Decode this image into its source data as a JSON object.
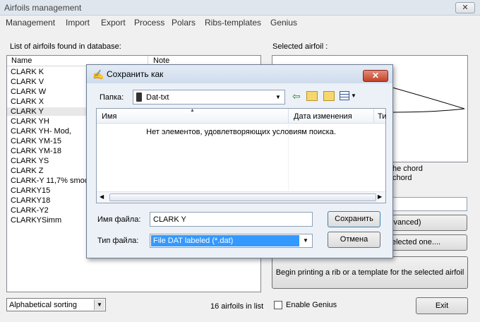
{
  "window": {
    "title": "Airfoils management",
    "close_glyph": "✕"
  },
  "menu": [
    "Management",
    "Import",
    "Export",
    "Process",
    "Polars",
    "Ribs-templates",
    "Genius"
  ],
  "left": {
    "list_label": "List of airfoils found in database:",
    "columns": [
      "Name",
      "Note"
    ],
    "airfoils": [
      "CLARK K",
      "CLARK V",
      "CLARK W",
      "CLARK X",
      "CLARK Y",
      "CLARK YH",
      "CLARK YH- Mod,",
      "CLARK YM-15",
      "CLARK YM-18",
      "CLARK YS",
      "CLARK Z",
      "CLARK-Y 11,7% smoot",
      "CLARKY15",
      "CLARKY18",
      "CLARK-Y2",
      "CLARKYSimm"
    ],
    "selected_index": 4,
    "sort_value": "Alphabetical sorting",
    "count_text": "16 airfoils in list"
  },
  "right": {
    "selected_label": "Selected airfoil :",
    "chord_line1": "he chord",
    "chord_line2": "chord",
    "btn_advanced": "lvanced)",
    "btn_selected": "elected one....",
    "btn_print": "Begin printing a rib or a template for the selected airfoil",
    "genius_label": "Enable Genius",
    "exit_label": "Exit"
  },
  "dialog": {
    "title": "Сохранить как",
    "folder_label": "Папка:",
    "folder_value": "Dat-txt",
    "col_name": "Имя",
    "col_date": "Дата изменения",
    "col_type": "Ти",
    "empty_message": "Нет элементов, удовлетворяющих условиям поиска.",
    "filename_label": "Имя файла:",
    "filename_value": "CLARK Y",
    "filetype_label": "Тип файла:",
    "filetype_value": "File DAT labeled (*.dat)",
    "save_label": "Сохранить",
    "cancel_label": "Отмена"
  },
  "colors": {
    "accent": "#3399ff",
    "selection_bg": "#e8e8e8",
    "title_gradient": "#cfdced"
  }
}
